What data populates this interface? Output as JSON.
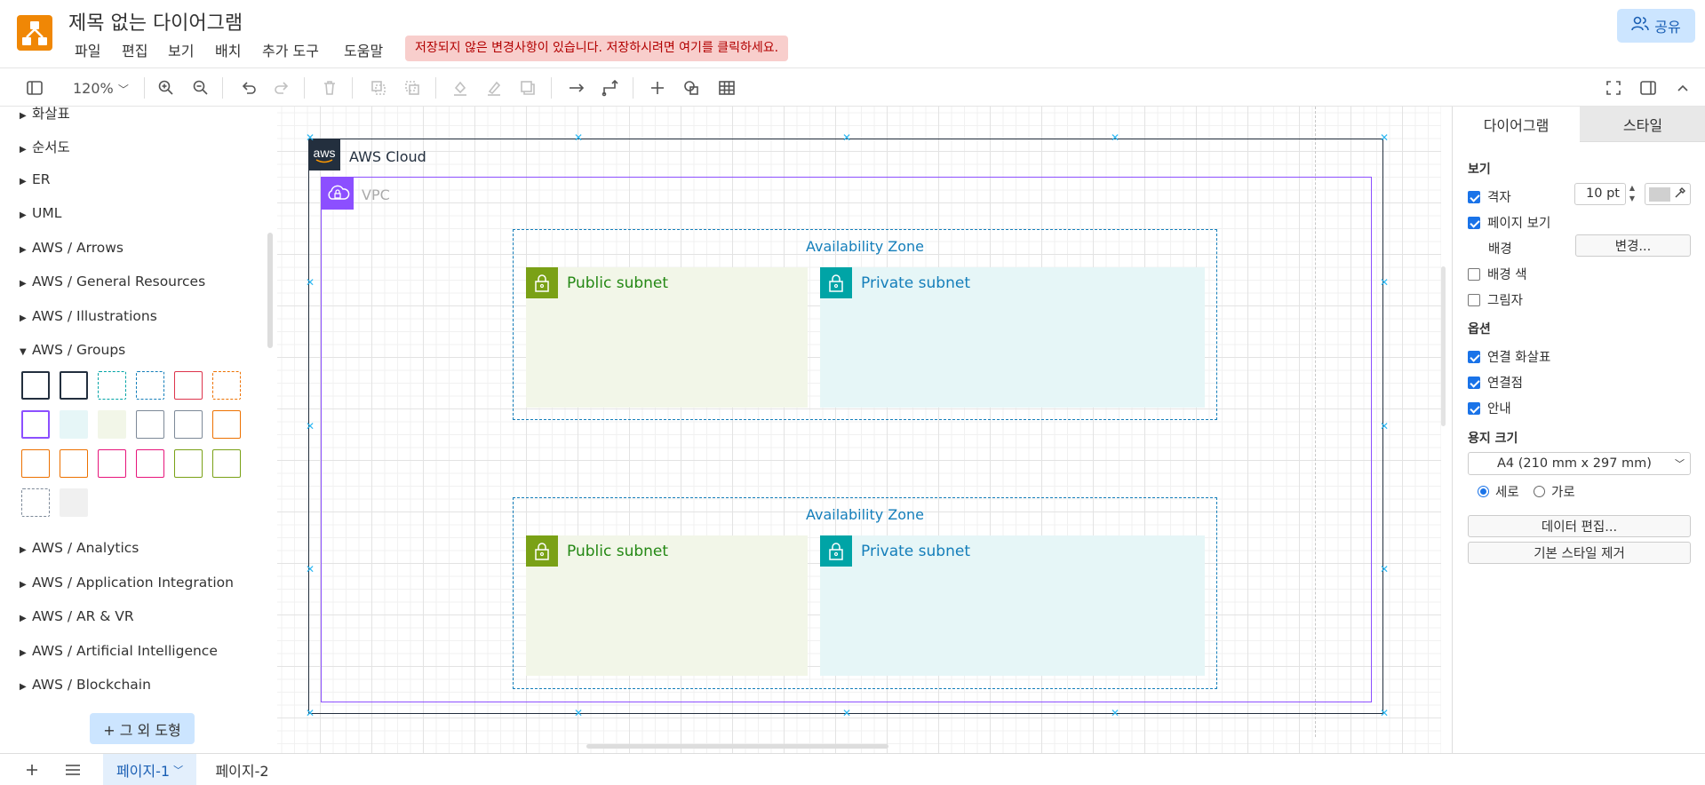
{
  "app": {
    "title": "제목 없는 다이어그램",
    "menus": [
      "파일",
      "편집",
      "보기",
      "배치",
      "추가 도구",
      "도움말"
    ],
    "unsaved_notice": "저장되지 않은 변경사항이 있습니다. 저장하시려면 여기를 클릭하세요.",
    "share_label": "공유"
  },
  "toolbar": {
    "zoom": "120%",
    "icons": [
      "sidebar-toggle-icon",
      "zoom-in-icon",
      "zoom-out-icon",
      "undo-icon",
      "redo-icon",
      "delete-icon",
      "to-front-icon",
      "to-back-icon",
      "fill-color-icon",
      "line-color-icon",
      "shadow-icon",
      "connection-icon",
      "waypoints-icon",
      "insert-icon",
      "shapes-icon",
      "table-icon",
      "fullscreen-icon",
      "format-panel-icon",
      "collapse-icon"
    ]
  },
  "sidebar": {
    "categories_top": [
      {
        "label": "화살표",
        "expanded": false
      },
      {
        "label": "순서도",
        "expanded": false
      },
      {
        "label": "ER",
        "expanded": false
      },
      {
        "label": "UML",
        "expanded": false
      },
      {
        "label": "AWS / Arrows",
        "expanded": false
      },
      {
        "label": "AWS / General Resources",
        "expanded": false
      },
      {
        "label": "AWS / Illustrations",
        "expanded": false
      },
      {
        "label": "AWS / Groups",
        "expanded": true
      }
    ],
    "categories_bottom": [
      {
        "label": "AWS / Analytics",
        "expanded": false
      },
      {
        "label": "AWS / Application Integration",
        "expanded": false
      },
      {
        "label": "AWS / AR & VR",
        "expanded": false
      },
      {
        "label": "AWS / Artificial Intelligence",
        "expanded": false
      },
      {
        "label": "AWS / Blockchain",
        "expanded": false
      }
    ],
    "more_shapes": "+ 그 외 도형"
  },
  "diagram": {
    "cloud_label": "AWS Cloud",
    "cloud_icon_text": "aws",
    "vpc_label": "VPC",
    "zones": [
      {
        "label": "Availability Zone",
        "public": "Public subnet",
        "private": "Private subnet"
      },
      {
        "label": "Availability Zone",
        "public": "Public subnet",
        "private": "Private subnet"
      }
    ],
    "colors": {
      "cloud_border": "#232f3e",
      "vpc": "#8c4fff",
      "zone": "#147eba",
      "public_fill": "#f2f6e8",
      "public_icon": "#7aa116",
      "public_text": "#248814",
      "private_fill": "#e6f6f7",
      "private_icon": "#00a4a6",
      "private_text": "#147eba"
    }
  },
  "format_panel": {
    "tabs": [
      "다이어그램",
      "스타일"
    ],
    "view_title": "보기",
    "grid_label": "격자",
    "grid_checked": true,
    "grid_size": "10 pt",
    "page_view_label": "페이지 보기",
    "page_view_checked": true,
    "background_label": "배경",
    "change_button": "변경...",
    "background_color_label": "배경 색",
    "background_color_checked": false,
    "shadow_label": "그림자",
    "shadow_checked": false,
    "options_title": "옵션",
    "connection_arrows_label": "연결 화살표",
    "connection_arrows_checked": true,
    "connection_points_label": "연결점",
    "connection_points_checked": true,
    "guides_label": "안내",
    "guides_checked": true,
    "paper_size_title": "용지 크기",
    "paper_size_value": "A4 (210 mm x 297 mm)",
    "portrait_label": "세로",
    "landscape_label": "가로",
    "orientation": "portrait",
    "edit_data_button": "데이터 편집...",
    "clear_style_button": "기본 스타일 제거"
  },
  "pages": {
    "tabs": [
      "페이지-1",
      "페이지-2"
    ],
    "active_index": 0
  }
}
